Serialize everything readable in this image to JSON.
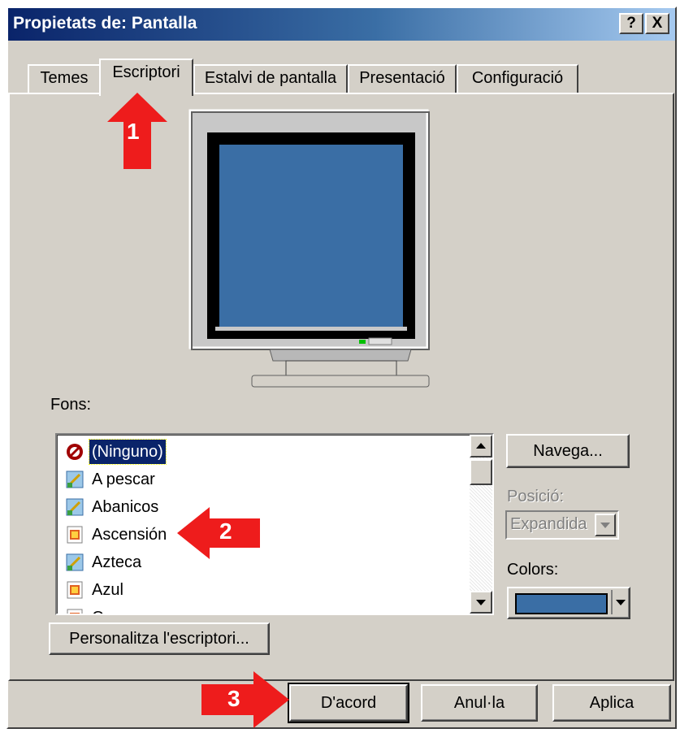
{
  "window": {
    "title": "Propietats de: Pantalla",
    "help_button": "?",
    "close_button": "X"
  },
  "tabs": [
    {
      "label": "Temes"
    },
    {
      "label": "Escriptori"
    },
    {
      "label": "Estalvi de pantalla"
    },
    {
      "label": "Presentació"
    },
    {
      "label": "Configuració"
    }
  ],
  "background_label": "Fons:",
  "backgrounds": [
    {
      "label": "(Ninguno)",
      "icon": "none-icon",
      "selected": true
    },
    {
      "label": "A pescar",
      "icon": "image-file-icon"
    },
    {
      "label": "Abanicos",
      "icon": "image-file-icon"
    },
    {
      "label": "Ascensión",
      "icon": "html-file-icon"
    },
    {
      "label": "Azteca",
      "icon": "image-file-icon"
    },
    {
      "label": "Azul",
      "icon": "html-file-icon"
    },
    {
      "label": "Casa",
      "icon": "html-file-icon"
    }
  ],
  "browse_button": "Navega...",
  "position_label": "Posició:",
  "position_value": "Expandida",
  "colors_label": "Colors:",
  "customize_button": "Personalitza l'escriptori...",
  "ok_button": "D'acord",
  "cancel_button": "Anul·la",
  "apply_button": "Aplica",
  "annotations": [
    {
      "number": "1"
    },
    {
      "number": "2"
    },
    {
      "number": "3"
    }
  ],
  "colors": {
    "title_start": "#0a246a",
    "preview_screen": "#3a6ea5",
    "selected_color": "#3a6ea5",
    "annotation": "#ee1c1c"
  }
}
